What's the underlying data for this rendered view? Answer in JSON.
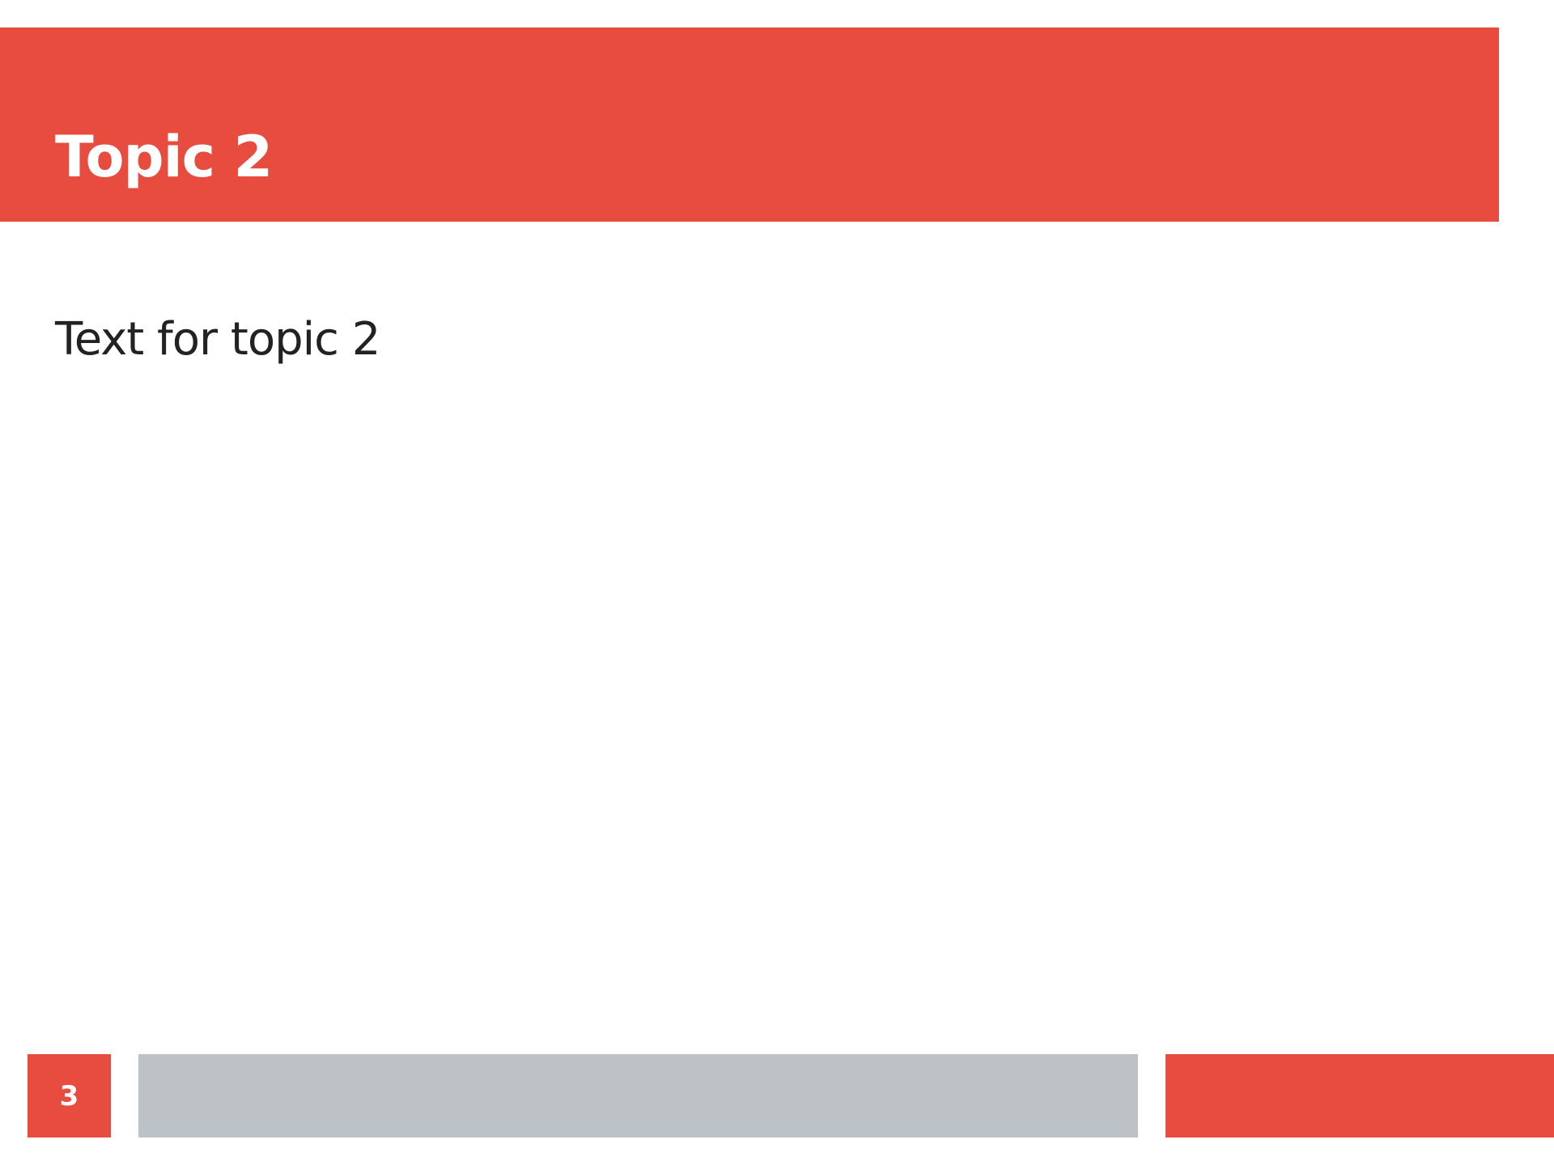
{
  "slide": {
    "title": "Topic 2",
    "body_text": "Text for topic 2",
    "page_number": "3"
  },
  "colors": {
    "accent": "#e74c3f",
    "footer_gray": "#bdc2c6",
    "text_dark": "#222222",
    "background": "#ffffff"
  }
}
